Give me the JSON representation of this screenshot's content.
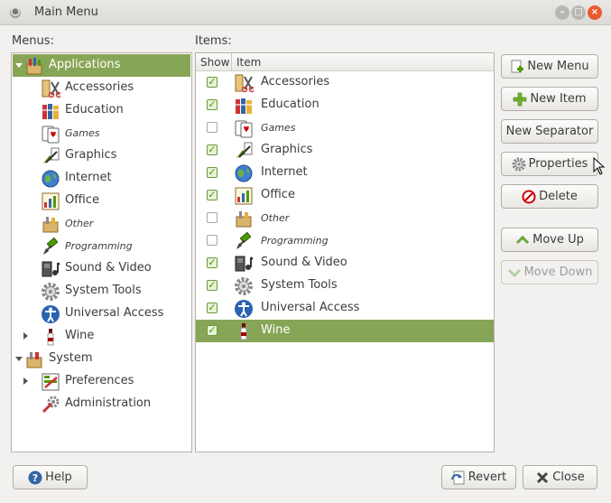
{
  "window": {
    "title": "Main Menu"
  },
  "menus_label": "Menus:",
  "items_label": "Items:",
  "menus": [
    {
      "label": "Applications",
      "icon": "applications-icon",
      "level": 0,
      "expander": "open",
      "selected": true,
      "italic": false
    },
    {
      "label": "Accessories",
      "icon": "accessories-icon",
      "level": 1,
      "expander": "none",
      "selected": false,
      "italic": false
    },
    {
      "label": "Education",
      "icon": "education-icon",
      "level": 1,
      "expander": "none",
      "selected": false,
      "italic": false
    },
    {
      "label": "Games",
      "icon": "games-icon",
      "level": 1,
      "expander": "none",
      "selected": false,
      "italic": true
    },
    {
      "label": "Graphics",
      "icon": "graphics-icon",
      "level": 1,
      "expander": "none",
      "selected": false,
      "italic": false
    },
    {
      "label": "Internet",
      "icon": "internet-icon",
      "level": 1,
      "expander": "none",
      "selected": false,
      "italic": false
    },
    {
      "label": "Office",
      "icon": "office-icon",
      "level": 1,
      "expander": "none",
      "selected": false,
      "italic": false
    },
    {
      "label": "Other",
      "icon": "other-icon",
      "level": 1,
      "expander": "none",
      "selected": false,
      "italic": true
    },
    {
      "label": "Programming",
      "icon": "programming-icon",
      "level": 1,
      "expander": "none",
      "selected": false,
      "italic": true
    },
    {
      "label": "Sound & Video",
      "icon": "sound-video-icon",
      "level": 1,
      "expander": "none",
      "selected": false,
      "italic": false
    },
    {
      "label": "System Tools",
      "icon": "system-tools-icon",
      "level": 1,
      "expander": "none",
      "selected": false,
      "italic": false
    },
    {
      "label": "Universal Access",
      "icon": "universal-access-icon",
      "level": 1,
      "expander": "none",
      "selected": false,
      "italic": false
    },
    {
      "label": "Wine",
      "icon": "wine-icon",
      "level": 1,
      "expander": "closed",
      "selected": false,
      "italic": false
    },
    {
      "label": "System",
      "icon": "system-icon",
      "level": 0,
      "expander": "open",
      "selected": false,
      "italic": false
    },
    {
      "label": "Preferences",
      "icon": "preferences-icon",
      "level": 1,
      "expander": "closed",
      "selected": false,
      "italic": false
    },
    {
      "label": "Administration",
      "icon": "administration-icon",
      "level": 1,
      "expander": "none",
      "selected": false,
      "italic": false
    }
  ],
  "items_columns": {
    "show": "Show",
    "item": "Item"
  },
  "items": [
    {
      "label": "Accessories",
      "icon": "accessories-icon",
      "show": true,
      "selected": false,
      "italic": false
    },
    {
      "label": "Education",
      "icon": "education-icon",
      "show": true,
      "selected": false,
      "italic": false
    },
    {
      "label": "Games",
      "icon": "games-icon",
      "show": false,
      "selected": false,
      "italic": true
    },
    {
      "label": "Graphics",
      "icon": "graphics-icon",
      "show": true,
      "selected": false,
      "italic": false
    },
    {
      "label": "Internet",
      "icon": "internet-icon",
      "show": true,
      "selected": false,
      "italic": false
    },
    {
      "label": "Office",
      "icon": "office-icon",
      "show": true,
      "selected": false,
      "italic": false
    },
    {
      "label": "Other",
      "icon": "other-icon",
      "show": false,
      "selected": false,
      "italic": true
    },
    {
      "label": "Programming",
      "icon": "programming-icon",
      "show": false,
      "selected": false,
      "italic": true
    },
    {
      "label": "Sound & Video",
      "icon": "sound-video-icon",
      "show": true,
      "selected": false,
      "italic": false
    },
    {
      "label": "System Tools",
      "icon": "system-tools-icon",
      "show": true,
      "selected": false,
      "italic": false
    },
    {
      "label": "Universal Access",
      "icon": "universal-access-icon",
      "show": true,
      "selected": false,
      "italic": false
    },
    {
      "label": "Wine",
      "icon": "wine-icon",
      "show": true,
      "selected": true,
      "italic": false
    }
  ],
  "buttons": {
    "new_menu": "New Menu",
    "new_item": "New Item",
    "new_separator": "New Separator",
    "properties": "Properties",
    "delete": "Delete",
    "move_up": "Move Up",
    "move_down": "Move Down",
    "help": "Help",
    "revert": "Revert",
    "close": "Close"
  },
  "colors": {
    "selection": "#87a556",
    "close_button": "#e95a31",
    "check": "#4e9a06"
  }
}
